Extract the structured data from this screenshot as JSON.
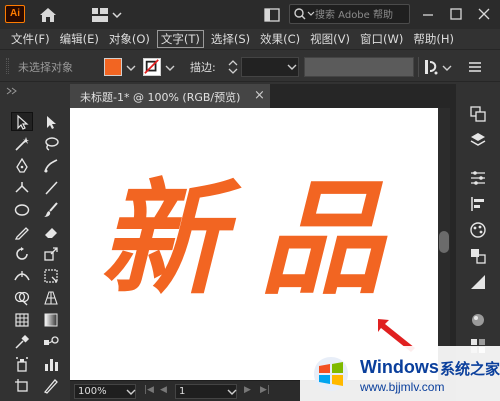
{
  "app": {
    "logo_text": "Ai"
  },
  "titlebar": {
    "search_placeholder": "搜索 Adobe 帮助",
    "icons": [
      "home-icon",
      "workspace-layout-icon",
      "arrange-window-icon",
      "search-icon",
      "minimize-icon",
      "maximize-icon",
      "close-icon"
    ]
  },
  "menu": {
    "items": [
      {
        "label": "文件(F)"
      },
      {
        "label": "编辑(E)"
      },
      {
        "label": "对象(O)"
      },
      {
        "label": "文字(T)",
        "active": true
      },
      {
        "label": "选择(S)"
      },
      {
        "label": "效果(C)"
      },
      {
        "label": "视图(V)"
      },
      {
        "label": "窗口(W)"
      },
      {
        "label": "帮助(H)"
      }
    ]
  },
  "control": {
    "selection_status": "未选择对象",
    "stroke_label": "描边:",
    "fill_color": "#f26522",
    "stroke_value": "",
    "profile_value": ""
  },
  "document": {
    "tab_label": "未标题-1* @ 100% (RGB/预览)",
    "tab_close": "×"
  },
  "artwork": {
    "text": "新品",
    "chars": [
      "新",
      "品"
    ],
    "color": "#f26522"
  },
  "status": {
    "zoom": "100%",
    "page": "1"
  },
  "watermark": {
    "brand": "Windows",
    "brand_cn": "系统之家",
    "url": "www.bjjmlv.com"
  },
  "colors": {
    "accent_orange": "#f26522",
    "ui_dark": "#323232",
    "arrow_red": "#e02020"
  }
}
